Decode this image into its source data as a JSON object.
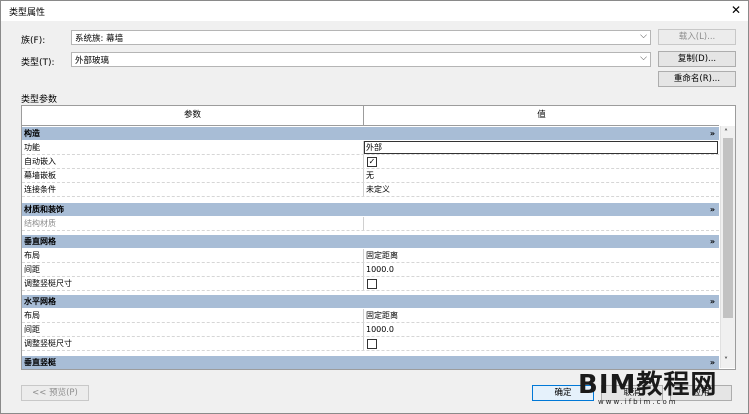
{
  "window": {
    "title": "类型属性",
    "close": "✕"
  },
  "family": {
    "label": "族(F):",
    "value": "系统族: 幕墙"
  },
  "type": {
    "label": "类型(T):",
    "value": "外部玻璃"
  },
  "buttons": {
    "load": "载入(L)...",
    "duplicate": "复制(D)...",
    "rename": "重命名(R)..."
  },
  "section_label": "类型参数",
  "table": {
    "col_param": "参数",
    "col_value": "值",
    "groups": [
      {
        "title": "构造",
        "rows": [
          {
            "param": "功能",
            "value": "外部"
          },
          {
            "param": "自动嵌入",
            "value": "",
            "checkbox": true,
            "checked": true
          },
          {
            "param": "幕墙嵌板",
            "value": "无"
          },
          {
            "param": "连接条件",
            "value": "未定义"
          }
        ]
      },
      {
        "title": "材质和装饰",
        "rows": [
          {
            "param": "结构材质",
            "value": ""
          }
        ]
      },
      {
        "title": "垂直网格",
        "rows": [
          {
            "param": "布局",
            "value": "固定距离"
          },
          {
            "param": "间距",
            "value": "1000.0"
          },
          {
            "param": "调整竖梃尺寸",
            "value": "",
            "checkbox": true,
            "checked": false
          }
        ]
      },
      {
        "title": "水平网格",
        "rows": [
          {
            "param": "布局",
            "value": "固定距离"
          },
          {
            "param": "间距",
            "value": "1000.0"
          },
          {
            "param": "调整竖梃尺寸",
            "value": "",
            "checkbox": true,
            "checked": false
          }
        ]
      },
      {
        "title": "垂直竖梃",
        "rows": []
      }
    ],
    "collapse_glyph": "»"
  },
  "footer": {
    "preview": "<< 预览(P)",
    "ok": "确定",
    "cancel": "取消",
    "apply": "应用"
  },
  "watermark": {
    "main": "BIM教程网",
    "url": "www.ifbim.com"
  },
  "colors": {
    "group_band": "#a8bdd6",
    "dialog_bg": "#f0f0f0"
  }
}
